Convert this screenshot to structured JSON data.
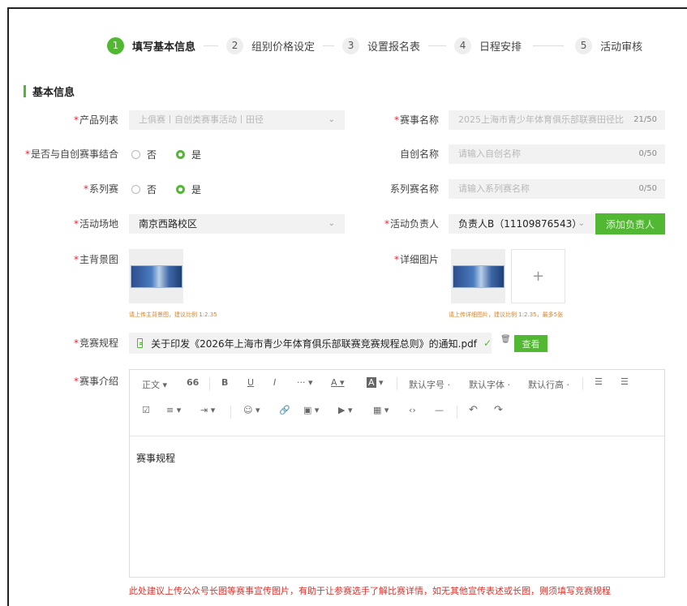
{
  "steps": [
    {
      "num": "1",
      "label": "填写基本信息",
      "active": true
    },
    {
      "num": "2",
      "label": "组别价格设定"
    },
    {
      "num": "3",
      "label": "设置报名表"
    },
    {
      "num": "4",
      "label": "日程安排"
    },
    {
      "num": "5",
      "label": "活动审核"
    }
  ],
  "section_title": "基本信息",
  "form": {
    "product_label": "产品列表",
    "product_value": "上俱赛丨自创类赛事活动丨田径",
    "event_name_label": "赛事名称",
    "event_name_value": "2025上海市青少年体育俱乐部联赛田径比",
    "event_name_count": "21/50",
    "self_combine_label": "是否与自创赛事结合",
    "self_name_label": "自创名称",
    "self_name_placeholder": "请输入自创名称",
    "self_name_count": "0/50",
    "series_label": "系列赛",
    "series_name_label": "系列赛名称",
    "series_name_placeholder": "请输入系列赛名称",
    "series_name_count": "0/50",
    "radio_no": "否",
    "radio_yes": "是",
    "venue_label": "活动场地",
    "venue_value": "南京西路校区",
    "manager_label": "活动负责人",
    "manager_value": "负责人B（11109876543）",
    "add_manager_button": "添加负责人",
    "main_bg_label": "主背景图",
    "main_bg_hint": "请上传主背景图，建议比例 1:2.35",
    "detail_img_label": "详细图片",
    "detail_img_hint": "请上传详细图片，建议比例 1:2.35，最多5张",
    "plus": "+",
    "rules_label": "竞赛规程",
    "rules_file": "关于印发《2026年上海市青少年体育俱乐部联赛竞赛规程总则》的通知.pdf",
    "view_button": "查看",
    "intro_label": "赛事介绍"
  },
  "toolbar": {
    "paragraph": "正文",
    "quote": "66",
    "bold": "B",
    "underline": "U",
    "italic": "I",
    "more": "···",
    "font_color": "A",
    "bg_color": "A",
    "font_size": "默认字号",
    "font_family": "默认字体",
    "line_height": "默认行高",
    "ul": "☰",
    "ol": "☰",
    "todo": "☑",
    "align": "≡",
    "indent": "⇥",
    "emoji": "☺",
    "link": "🔗",
    "image": "▣",
    "video": "▶",
    "table": "▦",
    "code": "‹›",
    "divider": "—",
    "undo": "↶",
    "redo": "↷"
  },
  "editor_content": "赛事规程",
  "bottom_note": "此处建议上传公众号长图等赛事宣传图片，有助于让参赛选手了解比赛详情，如无其他宣传表述或长图，则须填写竞赛规程",
  "colors": {
    "accent": "#52b733",
    "required": "#e23333",
    "hint": "#d9822b"
  }
}
